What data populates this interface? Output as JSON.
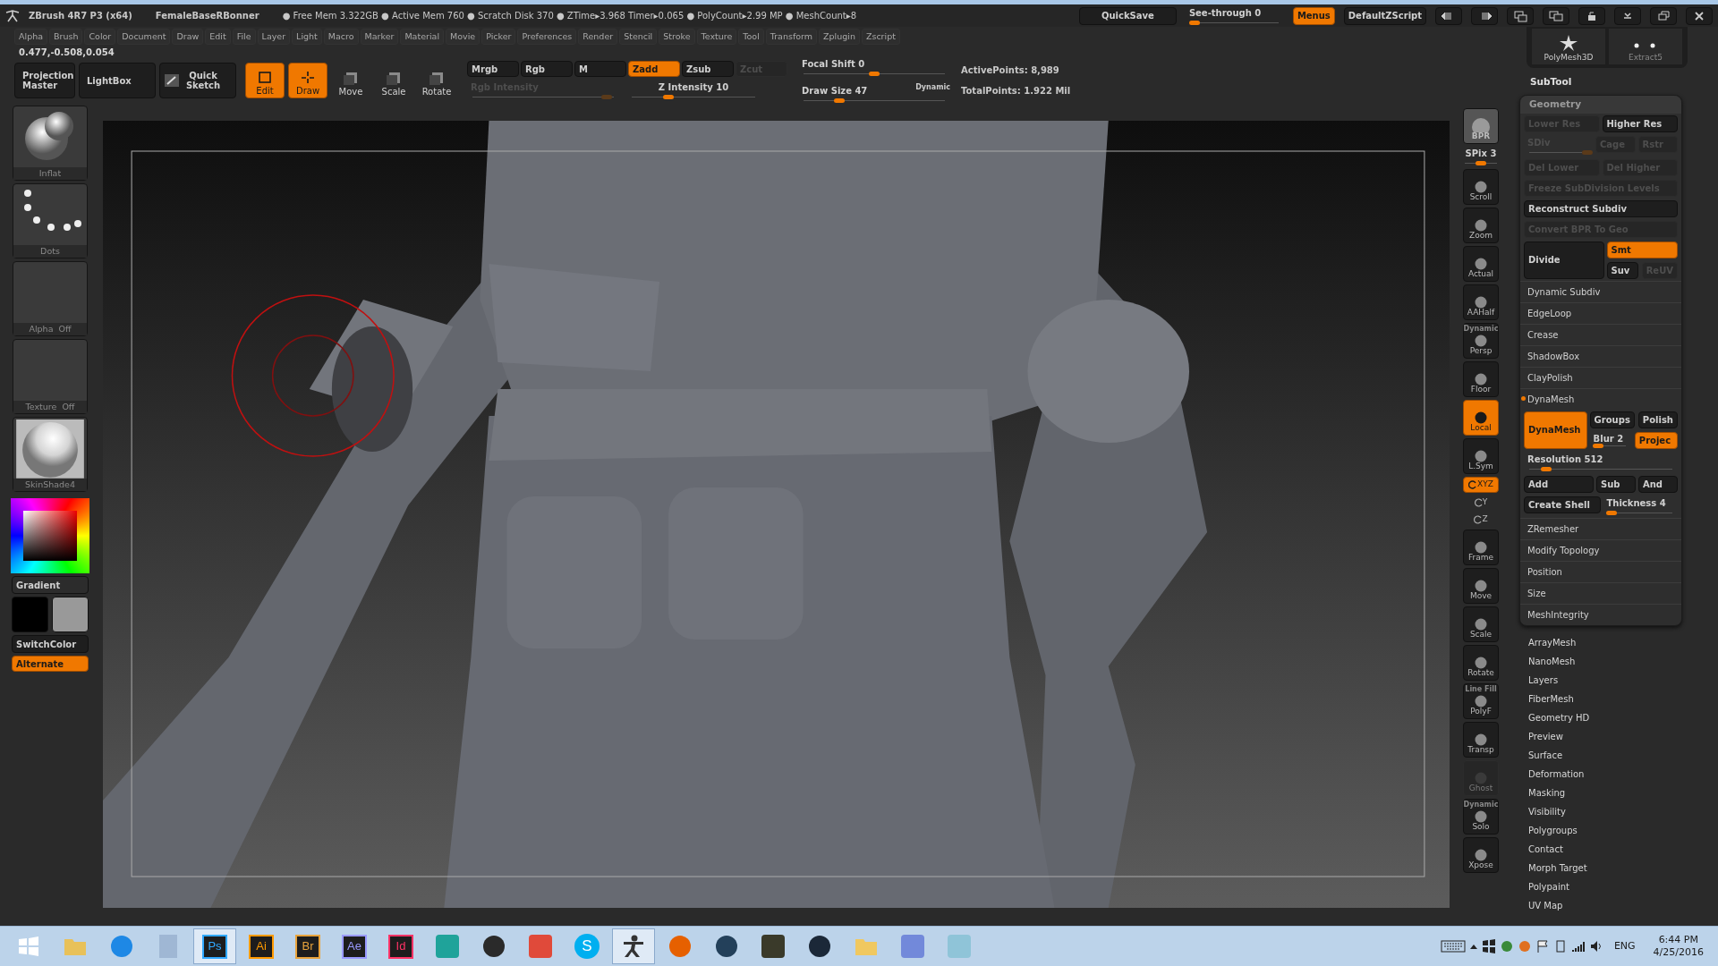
{
  "title_bar": {
    "app": "ZBrush 4R7 P3 (x64)",
    "document": "FemaleBaseRBonner",
    "status": "● Free Mem 3.322GB ● Active Mem 760 ● Scratch Disk 370 ● ZTime▸3.968 Timer▸0.065 ● PolyCount▸2.99 MP ● MeshCount▸8",
    "quicksave": "QuickSave",
    "see_through": {
      "label": "See-through  0",
      "level": 0.04
    },
    "menus": {
      "label": "Menus",
      "on": true
    },
    "script": "DefaultZScript"
  },
  "menu_bar": [
    "Alpha",
    "Brush",
    "Color",
    "Document",
    "Draw",
    "Edit",
    "File",
    "Layer",
    "Light",
    "Macro",
    "Marker",
    "Material",
    "Movie",
    "Picker",
    "Preferences",
    "Render",
    "Stencil",
    "Stroke",
    "Texture",
    "Tool",
    "Transform",
    "Zplugin",
    "Zscript"
  ],
  "coordinates": "0.477,-0.508,0.054",
  "top_shelf": {
    "buttons": [
      {
        "label": "Projection Master",
        "kind": "wide",
        "on": false
      },
      {
        "label": "LightBox",
        "kind": "wide",
        "on": false
      },
      {
        "label": "Quick Sketch",
        "kind": "sketch",
        "on": false
      },
      {
        "label": "Edit",
        "kind": "edit",
        "on": true
      },
      {
        "label": "Draw",
        "kind": "draw",
        "on": true
      },
      {
        "label": "Move",
        "kind": "letter",
        "on": false
      },
      {
        "label": "Scale",
        "kind": "letter",
        "on": false
      },
      {
        "label": "Rotate",
        "kind": "letter",
        "on": false
      }
    ],
    "modes": [
      {
        "label": "Mrgb",
        "on": false,
        "disabled": false
      },
      {
        "label": "Rgb",
        "on": false,
        "disabled": false
      },
      {
        "label": "M",
        "on": false,
        "disabled": false
      },
      {
        "label": "Zadd",
        "on": true,
        "disabled": false
      },
      {
        "label": "Zsub",
        "on": false,
        "disabled": false
      },
      {
        "label": "Zcut",
        "on": false,
        "disabled": true
      }
    ],
    "sliders": [
      {
        "label": "Rgb Intensity",
        "disabled": true,
        "level": 0.95
      },
      {
        "label": "Z Intensity 10",
        "disabled": false,
        "level": 0.3
      },
      {
        "label": "Focal Shift 0",
        "disabled": false,
        "level": 0.5
      },
      {
        "label": "Draw Size 47",
        "disabled": false,
        "level": 0.25
      }
    ],
    "dynamic": "Dynamic",
    "active_points": "ActivePoints: 8,989",
    "total_points": "TotalPoints: 1.922 Mil"
  },
  "left_shelf": {
    "thumbs": [
      {
        "label": "Inflat",
        "kind": "brush"
      },
      {
        "label": "Dots",
        "kind": "stroke"
      },
      {
        "label": "Alpha  Off",
        "kind": "empty"
      },
      {
        "label": "Texture  Off",
        "kind": "empty"
      },
      {
        "label": "SkinShade4",
        "kind": "material"
      }
    ],
    "gradient": "Gradient",
    "swatches": [
      {
        "color": "#000000"
      },
      {
        "color": "#999999"
      }
    ],
    "switch_color": "SwitchColor",
    "alternate": {
      "label": "Alternate",
      "on": true
    }
  },
  "right_shelf": [
    {
      "label": "BPR",
      "kind": "bpr",
      "on": false,
      "disabled": false
    },
    {
      "label": "SPix 3",
      "kind": "slider",
      "level": 0.5
    },
    {
      "label": "Scroll",
      "kind": "button",
      "on": false,
      "disabled": false
    },
    {
      "label": "Zoom",
      "kind": "button",
      "on": false,
      "disabled": false
    },
    {
      "label": "Actual",
      "kind": "button",
      "on": false,
      "disabled": false
    },
    {
      "label": "AAHalf",
      "kind": "button",
      "on": false,
      "disabled": false
    },
    {
      "label": "Persp",
      "kind": "button",
      "caption": "Dynamic",
      "on": false,
      "disabled": false
    },
    {
      "label": "Floor",
      "kind": "button",
      "on": false,
      "disabled": false
    },
    {
      "label": "Local",
      "kind": "button",
      "on": true,
      "disabled": false
    },
    {
      "label": "L.Sym",
      "kind": "button",
      "on": false,
      "disabled": false
    },
    {
      "label": "XYZ",
      "kind": "toggle",
      "on": true,
      "disabled": false
    },
    {
      "label": "Y",
      "kind": "axis",
      "on": false,
      "disabled": false
    },
    {
      "label": "Z",
      "kind": "axis",
      "on": false,
      "disabled": false
    },
    {
      "label": "Frame",
      "kind": "button",
      "on": false,
      "disabled": false
    },
    {
      "label": "Move",
      "kind": "button",
      "on": false,
      "disabled": false
    },
    {
      "label": "Scale",
      "kind": "button",
      "on": false,
      "disabled": false
    },
    {
      "label": "Rotate",
      "kind": "button",
      "on": false,
      "disabled": false
    },
    {
      "label": "PolyF",
      "kind": "button",
      "caption": "Line Fill",
      "on": false,
      "disabled": false
    },
    {
      "label": "Transp",
      "kind": "button",
      "on": false,
      "disabled": false
    },
    {
      "label": "Ghost",
      "kind": "button",
      "on": false,
      "disabled": true
    },
    {
      "label": "Solo",
      "kind": "button",
      "caption": "Dynamic",
      "on": false,
      "disabled": false
    },
    {
      "label": "Xpose",
      "kind": "button",
      "on": false,
      "disabled": false
    }
  ],
  "tray": {
    "subtools": [
      {
        "label": "PolyMesh3D",
        "kind": "star"
      },
      {
        "label": "Extract5",
        "kind": "dots"
      }
    ],
    "subtool_title": "SubTool",
    "geometry": {
      "title": "Geometry",
      "items": [
        {
          "kind": "row",
          "cells": [
            {
              "label": "Lower Res",
              "kind": "button",
              "on": false,
              "disabled": true
            },
            {
              "label": "Higher Res",
              "kind": "button",
              "on": false,
              "disabled": false
            }
          ]
        },
        {
          "kind": "row",
          "cells": [
            {
              "label": "SDiv",
              "kind": "slider",
              "disabled": true,
              "level": 1
            },
            {
              "label": "Cage",
              "kind": "button",
              "on": false,
              "disabled": true
            },
            {
              "label": "Rstr",
              "kind": "button",
              "on": false,
              "disabled": true
            }
          ]
        },
        {
          "kind": "row",
          "cells": [
            {
              "label": "Del Lower",
              "kind": "button",
              "on": false,
              "disabled": true
            },
            {
              "label": "Del Higher",
              "kind": "button",
              "on": false,
              "disabled": true
            }
          ]
        },
        {
          "kind": "row",
          "cells": [
            {
              "label": "Freeze SubDivision Levels",
              "kind": "button",
              "on": false,
              "disabled": true
            }
          ]
        },
        {
          "kind": "row",
          "cells": [
            {
              "label": "Reconstruct Subdiv",
              "kind": "button",
              "on": false,
              "disabled": false
            }
          ]
        },
        {
          "kind": "row",
          "cells": [
            {
              "label": "Convert BPR To Geo",
              "kind": "button",
              "on": false,
              "disabled": true
            }
          ]
        },
        {
          "kind": "block",
          "main": {
            "label": "Divide",
            "on": false
          },
          "rows": [
            [
              {
                "label": "Smt",
                "kind": "button",
                "on": true,
                "disabled": false
              }
            ],
            [
              {
                "label": "Suv",
                "kind": "button",
                "on": false,
                "disabled": false
              },
              {
                "label": "ReUV",
                "kind": "button",
                "on": false,
                "disabled": true
              }
            ]
          ]
        },
        {
          "kind": "section",
          "label": "Dynamic Subdiv",
          "expanded": false
        },
        {
          "kind": "section",
          "label": "EdgeLoop",
          "expanded": false
        },
        {
          "kind": "section",
          "label": "Crease",
          "expanded": false
        },
        {
          "kind": "section",
          "label": "ShadowBox",
          "expanded": false
        },
        {
          "kind": "section",
          "label": "ClayPolish",
          "expanded": false
        },
        {
          "kind": "section",
          "label": "DynaMesh",
          "expanded": true
        },
        {
          "kind": "block",
          "main": {
            "label": "DynaMesh",
            "on": true
          },
          "rows": [
            [
              {
                "label": "Groups",
                "kind": "button",
                "on": false,
                "disabled": false
              },
              {
                "label": "Polish",
                "kind": "button",
                "on": false,
                "disabled": false
              }
            ],
            [
              {
                "label": "Blur 2",
                "kind": "slider",
                "disabled": false,
                "level": 0.1
              },
              {
                "label": "Projec",
                "kind": "button",
                "on": true,
                "disabled": false
              }
            ]
          ]
        },
        {
          "kind": "row",
          "cells": [
            {
              "label": "Resolution 512",
              "kind": "slider",
              "disabled": false,
              "level": 0.12
            }
          ]
        },
        {
          "kind": "row",
          "cells": [
            {
              "label": "Add",
              "kind": "button",
              "on": false,
              "disabled": false
            },
            {
              "label": "Sub",
              "kind": "button",
              "on": false,
              "disabled": false
            },
            {
              "label": "And",
              "kind": "button",
              "on": false,
              "disabled": false
            }
          ]
        },
        {
          "kind": "row",
          "cells": [
            {
              "label": "Create Shell",
              "kind": "button",
              "on": false,
              "disabled": false
            },
            {
              "label": "Thickness 4",
              "kind": "slider",
              "disabled": false,
              "level": 0.05
            }
          ]
        },
        {
          "kind": "section",
          "label": "ZRemesher",
          "expanded": false
        },
        {
          "kind": "section",
          "label": "Modify Topology",
          "expanded": false
        },
        {
          "kind": "section",
          "label": "Position",
          "expanded": false
        },
        {
          "kind": "section",
          "label": "Size",
          "expanded": false
        },
        {
          "kind": "section",
          "label": "MeshIntegrity",
          "expanded": false
        }
      ]
    },
    "palettes": [
      "ArrayMesh",
      "NanoMesh",
      "Layers",
      "FiberMesh",
      "Geometry HD",
      "Preview",
      "Surface",
      "Deformation",
      "Masking",
      "Visibility",
      "Polygroups",
      "Contact",
      "Morph Target",
      "Polypaint",
      "UV Map"
    ]
  },
  "taskbar": {
    "apps": [
      {
        "kind": "folder",
        "color": "#e8c15a",
        "selected": false
      },
      {
        "kind": "globe",
        "color": "#1e88e5",
        "selected": false
      },
      {
        "kind": "calculator",
        "color": "#9fb7d4",
        "selected": false
      },
      {
        "kind": "letters",
        "text": "Ps",
        "color": "#31a8ff",
        "selected": true
      },
      {
        "kind": "letters",
        "text": "Ai",
        "color": "#ff9a00",
        "selected": false
      },
      {
        "kind": "letters",
        "text": "Br",
        "color": "#e8a33c",
        "selected": false
      },
      {
        "kind": "letters",
        "text": "Ae",
        "color": "#9999ff",
        "selected": false
      },
      {
        "kind": "letters",
        "text": "Id",
        "color": "#ff3366",
        "selected": false
      },
      {
        "kind": "tile",
        "color": "#1fa39a",
        "selected": false
      },
      {
        "kind": "globe",
        "color": "#2a2a2a",
        "selected": false
      },
      {
        "kind": "tile",
        "color": "#e04a3a",
        "selected": false
      },
      {
        "kind": "round",
        "text": "S",
        "color": "#00aff0",
        "selected": false
      },
      {
        "kind": "figure",
        "color": "#333333",
        "selected": true
      },
      {
        "kind": "globe",
        "color": "#e66000",
        "selected": false
      },
      {
        "kind": "globe",
        "color": "#23405a",
        "selected": false
      },
      {
        "kind": "tile",
        "color": "#3a3a2a",
        "selected": false
      },
      {
        "kind": "globe",
        "color": "#1b2838",
        "selected": false
      },
      {
        "kind": "folder",
        "color": "#f0c860",
        "selected": false
      },
      {
        "kind": "tile",
        "color": "#7289da",
        "selected": false
      },
      {
        "kind": "tile",
        "color": "#8fc4d8",
        "selected": false
      }
    ],
    "language": "ENG",
    "time": "6:44 PM",
    "date": "4/25/2016"
  }
}
